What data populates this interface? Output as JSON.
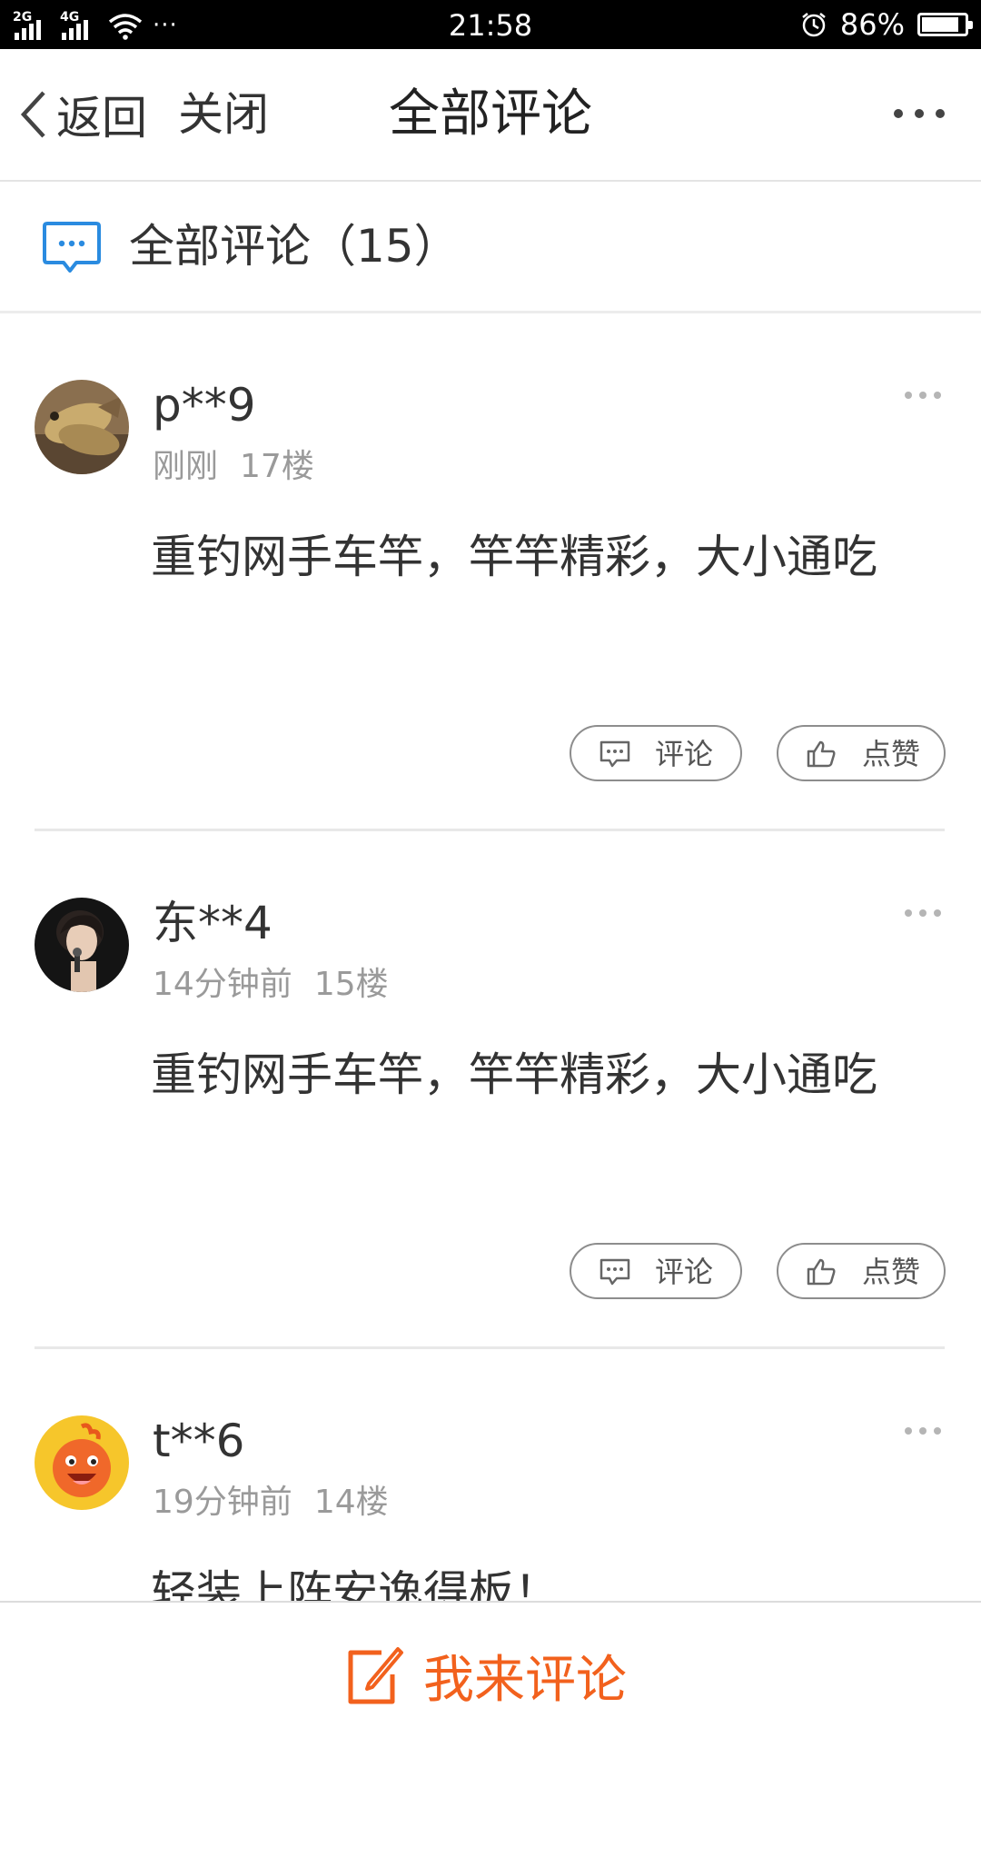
{
  "status_bar": {
    "signal1_label": "2G",
    "signal2_label": "4G",
    "more": "···",
    "time": "21:58",
    "battery_percent": "86%",
    "battery_level": 0.86,
    "icons": [
      "signal-icon",
      "wifi-icon",
      "alarm-icon",
      "battery-icon"
    ]
  },
  "nav": {
    "back_label": "返回",
    "close_label": "关闭",
    "title": "全部评论"
  },
  "section": {
    "title": "全部评论（15）"
  },
  "buttons": {
    "comment_label": "评论",
    "like_label": "点赞"
  },
  "comments": [
    {
      "user": "p**9",
      "time": "刚刚",
      "floor": "17楼",
      "text": "重钓网手车竿，竿竿精彩，大小通吃",
      "avatar": "fish-photo"
    },
    {
      "user": "东**4",
      "time": "14分钟前",
      "floor": "15楼",
      "text": "重钓网手车竿，竿竿精彩，大小通吃",
      "avatar": "person-photo"
    },
    {
      "user": "t**6",
      "time": "19分钟前",
      "floor": "14楼",
      "text": "轻装上阵安逸得板！",
      "avatar": "cartoon-mascot"
    }
  ],
  "bottom": {
    "write_label": "我来评论"
  },
  "colors": {
    "accent": "#f2611d",
    "icon_blue": "#2a8be0",
    "meta_gray": "#9a9a9a"
  }
}
